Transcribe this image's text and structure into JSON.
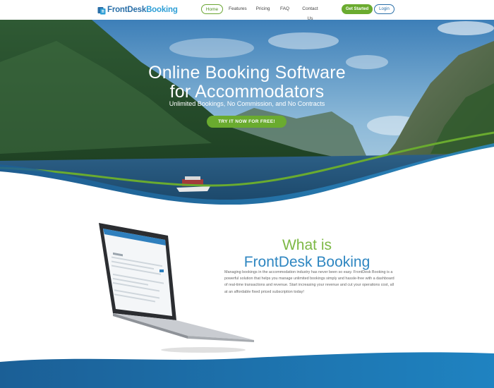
{
  "logo": {
    "part1": "FrontDesk",
    "part2": "Booking"
  },
  "nav": {
    "home": "Home",
    "features": "Features",
    "pricing": "Pricing",
    "faq": "FAQ",
    "contact": "Contact Us",
    "get_started": "Get Started",
    "login": "Login"
  },
  "hero": {
    "title_line1": "Online Booking Software",
    "title_line2": "for Accommodators",
    "subtitle": "Unlimited Bookings, No Commission, and No Contracts",
    "cta": "TRY IT NOW FOR FREE!"
  },
  "about": {
    "title_line1": "What is",
    "title_line2": "FrontDesk Booking",
    "body": "Managing bookings in the accommodation industry has never been so easy. FrontDesk Booking is a powerful solution that helps you manage unlimited bookings simply and hassle-free with a dashboard of real-time transactions and revenue. Start increasing your revenue and cut your operations cost, all at an affordable fixed priced subscription today!"
  },
  "colors": {
    "brand_blue": "#2a6fa8",
    "brand_light_blue": "#2e9fd6",
    "accent_green": "#6aab2f",
    "title_green": "#7db845"
  }
}
